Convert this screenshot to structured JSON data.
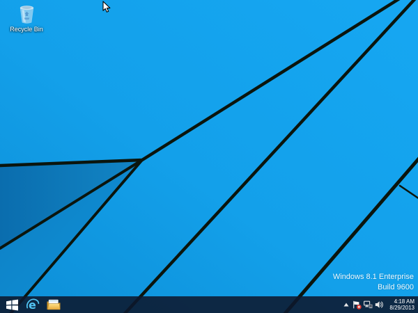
{
  "desktop": {
    "recycle_bin": {
      "label": "Recycle Bin"
    },
    "watermark": {
      "line1": "Windows 8.1 Enterprise",
      "line2": "Build 9600"
    }
  },
  "taskbar": {
    "buttons": [
      {
        "name": "start",
        "icon": "windows-logo-icon"
      },
      {
        "name": "internet-explorer",
        "icon": "ie-browser-icon"
      },
      {
        "name": "file-explorer",
        "icon": "folder-icon"
      }
    ],
    "tray": [
      {
        "name": "show-hidden-icons",
        "icon": "up-arrow-icon"
      },
      {
        "name": "action-center",
        "icon": "flag-alert-icon"
      },
      {
        "name": "network",
        "icon": "network-icon"
      },
      {
        "name": "volume",
        "icon": "speaker-icon"
      }
    ],
    "clock": {
      "time": "4:18 AM",
      "date": "8/29/2013"
    }
  },
  "colors": {
    "wallpaper_base": "#12A1EC",
    "wallpaper_dark_facet": "#0B74B8",
    "wallpaper_line": "#0B150D",
    "taskbar_background": "#0E1A2E",
    "ie_blue": "#53C6F5",
    "folder_gold": "#EFB73E",
    "alert_red": "#D9342B"
  }
}
